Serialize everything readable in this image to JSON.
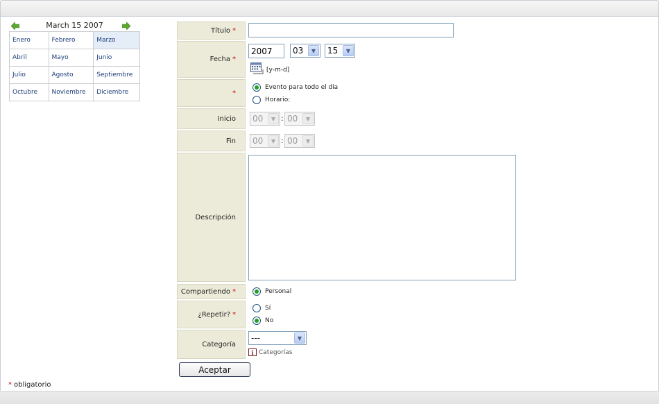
{
  "calendar": {
    "title": "March 15 2007",
    "prev_icon": "arrow-left-icon",
    "next_icon": "arrow-right-icon",
    "selected_month": "Marzo",
    "months": [
      [
        "Enero",
        "Febrero",
        "Marzo"
      ],
      [
        "Abril",
        "Mayo",
        "Junio"
      ],
      [
        "Julio",
        "Agosto",
        "Septiembre"
      ],
      [
        "Octubre",
        "Noviembre",
        "Diciembre"
      ]
    ]
  },
  "form": {
    "titulo_label": "Título",
    "titulo_value": "",
    "fecha_label": "Fecha",
    "fecha_year": "2007",
    "fecha_month": "03",
    "fecha_day": "15",
    "date_format_hint": "[y-m-d]",
    "date_picker_icon": "calendar-icon",
    "allday_option": "Evento para todo el día",
    "horario_option": "Horario:",
    "inicio_label": "Inicio",
    "inicio_hour": "00",
    "inicio_min": "00",
    "fin_label": "Fin",
    "fin_hour": "00",
    "fin_min": "00",
    "descripcion_label": "Descripción",
    "descripcion_value": "",
    "compartiendo_label": "Compartiendo",
    "personal_option": "Personal",
    "repetir_label": "¿Repetir?",
    "repetir_si": "Sí",
    "repetir_no": "No",
    "categoria_label": "Categoría",
    "categoria_value": "---",
    "categorias_link": "Categorías",
    "info_icon": "info-icon",
    "info_icon_text": "i",
    "accept_button": "Aceptar",
    "required_mark": "*",
    "colon": ":",
    "dropdown_glyph": "▼"
  },
  "footer": {
    "required_note": "obligatorio"
  },
  "colors": {
    "label_bg": "#ecebd9",
    "required": "#cc0000",
    "link": "#1b3d79",
    "selected_cell": "#e4edf8",
    "radio_dot": "#21a121"
  }
}
